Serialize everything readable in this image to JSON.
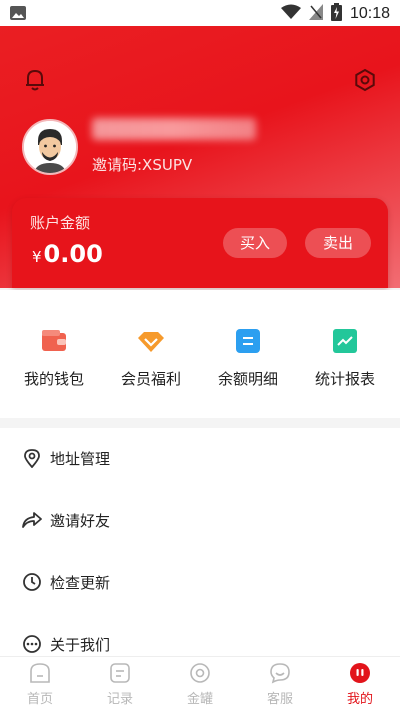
{
  "status_bar": {
    "time": "10:18"
  },
  "profile": {
    "invite_code": "邀请码:XSUPV"
  },
  "balance": {
    "label": "账户金额",
    "currency": "¥",
    "amount": "0.00",
    "buy_label": "买入",
    "sell_label": "卖出"
  },
  "quick_menu": [
    {
      "label": "我的钱包",
      "icon": "wallet-icon",
      "color": "#f0624f"
    },
    {
      "label": "会员福利",
      "icon": "diamond-icon",
      "color": "#f69a2c"
    },
    {
      "label": "余额明细",
      "icon": "detail-icon",
      "color": "#2c9ff0"
    },
    {
      "label": "统计报表",
      "icon": "chart-icon",
      "color": "#23c79a"
    }
  ],
  "menu_list": [
    {
      "label": "地址管理",
      "icon": "location-icon"
    },
    {
      "label": "邀请好友",
      "icon": "share-icon"
    },
    {
      "label": "检查更新",
      "icon": "clock-icon"
    },
    {
      "label": "关于我们",
      "icon": "more-icon"
    }
  ],
  "tabs": [
    {
      "label": "首页",
      "icon": "home-icon",
      "active": false
    },
    {
      "label": "记录",
      "icon": "record-icon",
      "active": false
    },
    {
      "label": "金罐",
      "icon": "jar-icon",
      "active": false
    },
    {
      "label": "客服",
      "icon": "service-icon",
      "active": false
    },
    {
      "label": "我的",
      "icon": "profile-icon",
      "active": true
    }
  ],
  "colors": {
    "brand_red": "#e8141c",
    "tab_inactive": "#b8b8b8"
  }
}
